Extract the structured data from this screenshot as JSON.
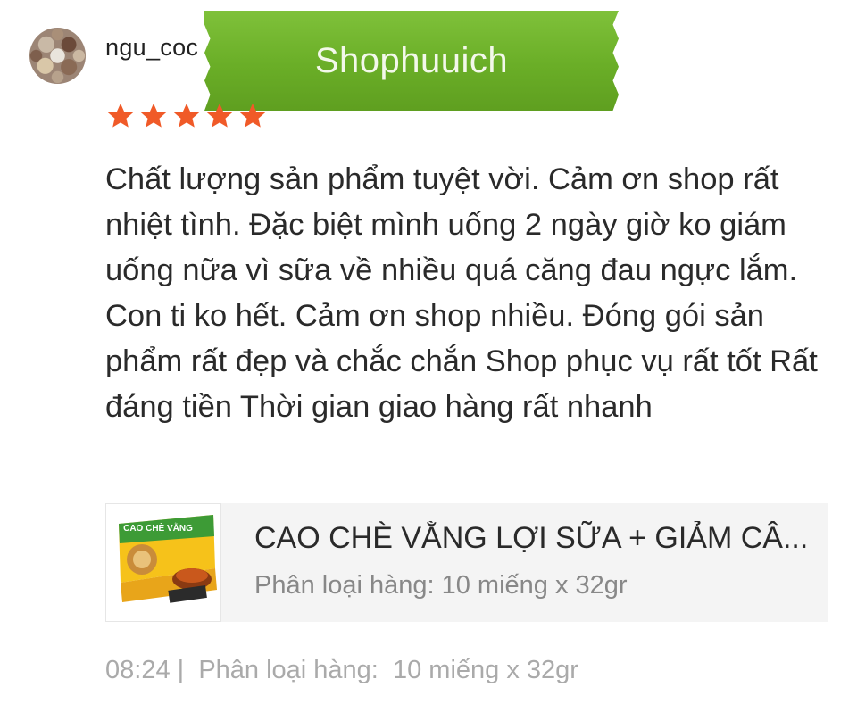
{
  "user": {
    "name": "ngu_coc"
  },
  "badge": {
    "text": "Shophuuich"
  },
  "rating": {
    "stars": 5,
    "max": 5,
    "color": "#f05a28"
  },
  "review": {
    "text": "Chất lượng sản phẩm tuyệt vời. Cảm ơn shop rất nhiệt tình. Đặc biệt mình uống 2 ngày giờ ko giám uống nữa vì sữa về nhiều quá căng đau ngực lắm. Con ti ko hết. Cảm ơn shop nhiều. Đóng gói sản phẩm rất đẹp và chắc chắn Shop phục vụ rất tốt Rất đáng tiền Thời gian giao hàng rất nhanh"
  },
  "product": {
    "title": "CAO CHÈ VẰNG LỢI SỮA + GIẢM CÂ...",
    "variant": "Phân loại hàng: 10 miếng x 32gr",
    "thumb_label": "CAO CHÈ VẰNG"
  },
  "footer": {
    "time": "08:24",
    "separator": "|",
    "variant": "Phân loại hàng:  10 miếng x 32gr"
  },
  "colors": {
    "badge_green": "#6aae27",
    "star_orange": "#f05a28"
  }
}
